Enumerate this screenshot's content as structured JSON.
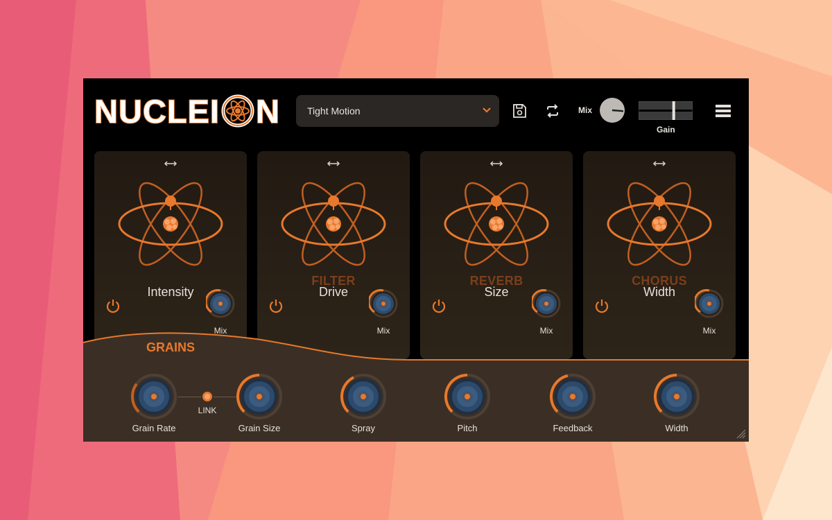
{
  "app": {
    "logo": "NUCLEI N",
    "logo_parts": [
      "NUCLEI",
      "N"
    ]
  },
  "header": {
    "preset_name": "Tight Motion",
    "mix_label": "Mix",
    "mix_value": 0.85,
    "gain_label": "Gain",
    "gain_value": 0.65
  },
  "panels": [
    {
      "title": "GRAINS",
      "param": "Intensity",
      "mix_label": "Mix",
      "active": true
    },
    {
      "title": "FILTER",
      "param": "Drive",
      "mix_label": "Mix",
      "active": false
    },
    {
      "title": "REVERB",
      "param": "Size",
      "mix_label": "Mix",
      "active": false
    },
    {
      "title": "CHORUS",
      "param": "Width",
      "mix_label": "Mix",
      "active": false
    }
  ],
  "grains": {
    "title": "GRAINS",
    "link_label": "LINK",
    "knobs": [
      {
        "label": "Grain Rate",
        "value": 0.3
      },
      {
        "label": "Grain Size",
        "value": 0.5
      },
      {
        "label": "Spray",
        "value": 0.4
      },
      {
        "label": "Pitch",
        "value": 0.5
      },
      {
        "label": "Feedback",
        "value": 0.45
      },
      {
        "label": "Width",
        "value": 0.5
      }
    ]
  },
  "colors": {
    "accent": "#e8792c",
    "accent_dim": "#7a3f1c",
    "panel_bg": "#2a2119",
    "bottom_bg": "#3a2f25",
    "knob_blue": "#2e4a6b"
  }
}
